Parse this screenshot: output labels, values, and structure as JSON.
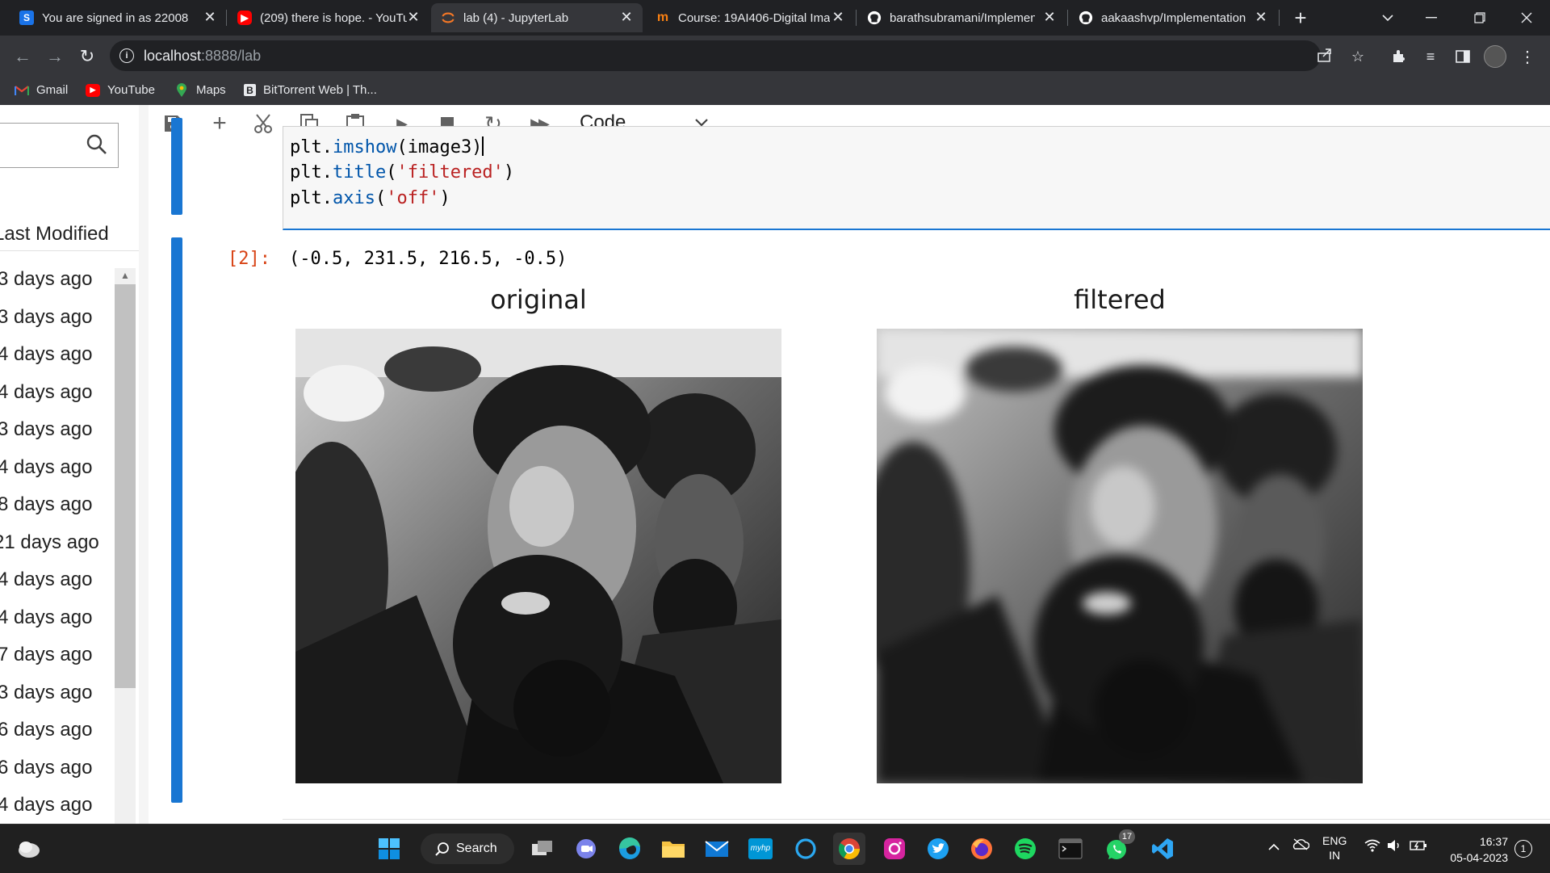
{
  "browser": {
    "tabs": [
      {
        "title": "You are signed in as 22008",
        "favicon": "S",
        "color": "#1a73e8",
        "active": false
      },
      {
        "title": "(209) there is hope. - YouTu",
        "favicon": "youtube-icon",
        "color": "#ff0000",
        "active": false
      },
      {
        "title": "lab (4) - JupyterLab",
        "favicon": "jupyter-icon",
        "color": "#f37726",
        "active": true
      },
      {
        "title": "Course: 19AI406-Digital Ima",
        "favicon": "m",
        "color": "#f98012",
        "active": false
      },
      {
        "title": "barathsubramani/Implemen",
        "favicon": "github-icon",
        "color": "#ffffff",
        "active": false
      },
      {
        "title": "aakaashvp/Implementation",
        "favicon": "github-icon",
        "color": "#ffffff",
        "active": false
      }
    ],
    "close_glyph": "✕",
    "new_tab_glyph": "+",
    "url_host": "localhost",
    "url_rest": ":8888/lab",
    "bookmarks": [
      {
        "label": "Gmail",
        "icon": "gmail-icon"
      },
      {
        "label": "YouTube",
        "icon": "youtube-icon"
      },
      {
        "label": "Maps",
        "icon": "maps-icon"
      },
      {
        "label": "BitTorrent Web | Th...",
        "icon": "bittorrent-icon"
      }
    ]
  },
  "jupyter": {
    "cell_type": "Code",
    "file_browser": {
      "column_header": "Last Modified",
      "rows": [
        "3 days ago",
        "3 days ago",
        "4 days ago",
        "4 days ago",
        "3 days ago",
        "4 days ago",
        "8 days ago",
        "21 days ago",
        "4 days ago",
        "4 days ago",
        "7 days ago",
        "3 days ago",
        "6 days ago",
        "6 days ago",
        "4 days ago"
      ]
    },
    "code_lines": [
      {
        "obj": "plt.",
        "fn": "imshow",
        "args": "(image3)",
        "cursor": true
      },
      {
        "obj": "plt.",
        "fn": "title",
        "args_open": "(",
        "string": "'filtered'",
        "args_close": ")"
      },
      {
        "obj": "plt.",
        "fn": "axis",
        "args_open": "(",
        "string": "'off'",
        "args_close": ")"
      }
    ],
    "output_prompt": "[2]:",
    "output_text": "(-0.5, 231.5, 216.5, -0.5)",
    "figures": [
      {
        "title": "original",
        "blur": 0
      },
      {
        "title": "filtered",
        "blur": 7
      }
    ]
  },
  "taskbar": {
    "search_label": "Search",
    "whatsapp_badge": "17",
    "language": "ENG",
    "region": "IN",
    "time": "16:37",
    "date": "05-04-2023",
    "notification_count": "1"
  },
  "colors": {
    "jupyter_blue": "#1976d2",
    "output_prompt": "#d84315",
    "code_function": "#0055aa",
    "code_string": "#ba2121"
  }
}
